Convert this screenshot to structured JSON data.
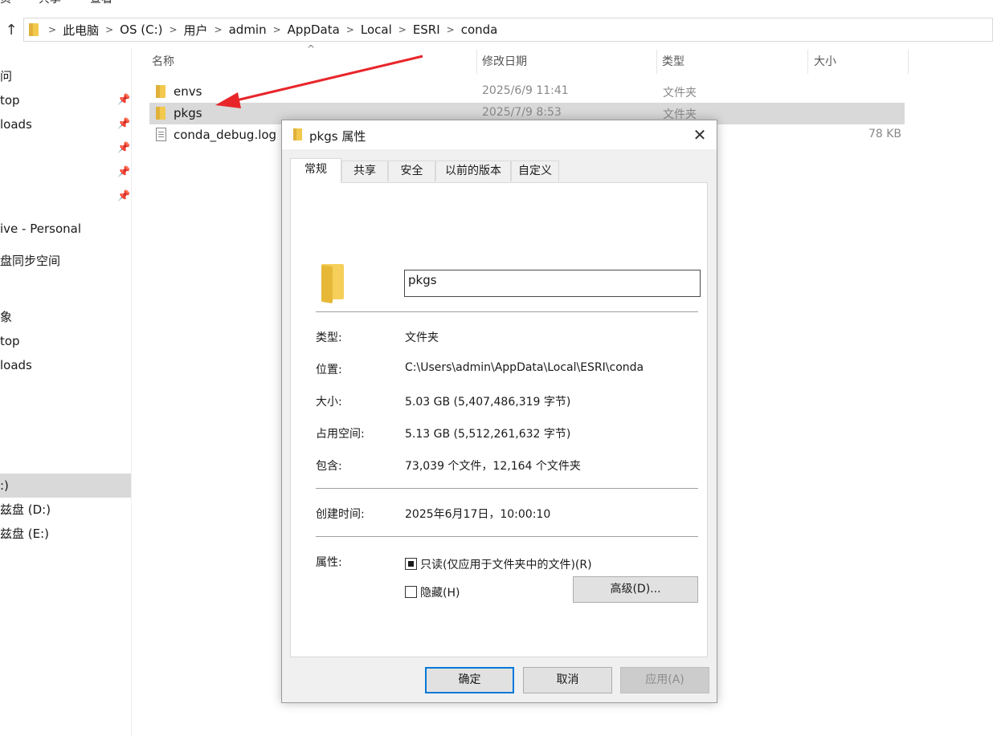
{
  "menu": {
    "items": [
      "页",
      "共享",
      "查看"
    ]
  },
  "address": {
    "crumbs": [
      "此电脑",
      "OS (C:)",
      "用户",
      "admin",
      "AppData",
      "Local",
      "ESRI",
      "conda"
    ]
  },
  "nav": {
    "items": [
      {
        "label": "问",
        "pinned": false
      },
      {
        "label": "top",
        "pinned": true
      },
      {
        "label": "loads",
        "pinned": true
      },
      {
        "label": "",
        "pinned": true
      },
      {
        "label": "",
        "pinned": true
      },
      {
        "label": "",
        "pinned": true
      },
      {
        "label": "ive - Personal",
        "pinned": false
      },
      {
        "label": "盘同步空间",
        "pinned": false
      },
      {
        "label": "象",
        "pinned": false
      },
      {
        "label": "top",
        "pinned": false
      },
      {
        "label": "loads",
        "pinned": false
      },
      {
        "label": ":)",
        "pinned": false,
        "selected": true
      },
      {
        "label": "兹盘 (D:)",
        "pinned": false
      },
      {
        "label": "兹盘 (E:)",
        "pinned": false
      }
    ]
  },
  "list": {
    "columns": {
      "name": "名称",
      "date": "修改日期",
      "type": "类型",
      "size": "大小"
    },
    "rows": [
      {
        "name": "envs",
        "date": "2025/6/9 11:41",
        "type": "文件夹",
        "size": "",
        "kind": "folder"
      },
      {
        "name": "pkgs",
        "date": "2025/7/9 8:53",
        "type": "文件夹",
        "size": "",
        "kind": "folder",
        "selected": true
      },
      {
        "name": "conda_debug.log",
        "date": "",
        "type": "",
        "size": "78 KB",
        "kind": "file"
      }
    ]
  },
  "dialog": {
    "title": "pkgs 属性",
    "tabs": [
      "常规",
      "共享",
      "安全",
      "以前的版本",
      "自定义"
    ],
    "active_tab": "常规",
    "name_value": "pkgs",
    "props": {
      "type_label": "类型:",
      "type_value": "文件夹",
      "location_label": "位置:",
      "location_value": "C:\\Users\\admin\\AppData\\Local\\ESRI\\conda",
      "size_label": "大小:",
      "size_value": "5.03 GB (5,407,486,319 字节)",
      "disk_label": "占用空间:",
      "disk_value": "5.13 GB (5,512,261,632 字节)",
      "contains_label": "包含:",
      "contains_value": "73,039 个文件，12,164 个文件夹",
      "created_label": "创建时间:",
      "created_value": "2025年6月17日，10:00:10",
      "attrs_label": "属性:"
    },
    "readonly_label": "只读(仅应用于文件夹中的文件)(R)",
    "hidden_label": "隐藏(H)",
    "advanced_label": "高级(D)...",
    "ok_label": "确定",
    "cancel_label": "取消",
    "apply_label": "应用(A)"
  },
  "colors": {
    "annotation": "#e8262a",
    "selection": "#d9d9d9",
    "accent": "#0078d7",
    "folder": "#f2c94c"
  }
}
